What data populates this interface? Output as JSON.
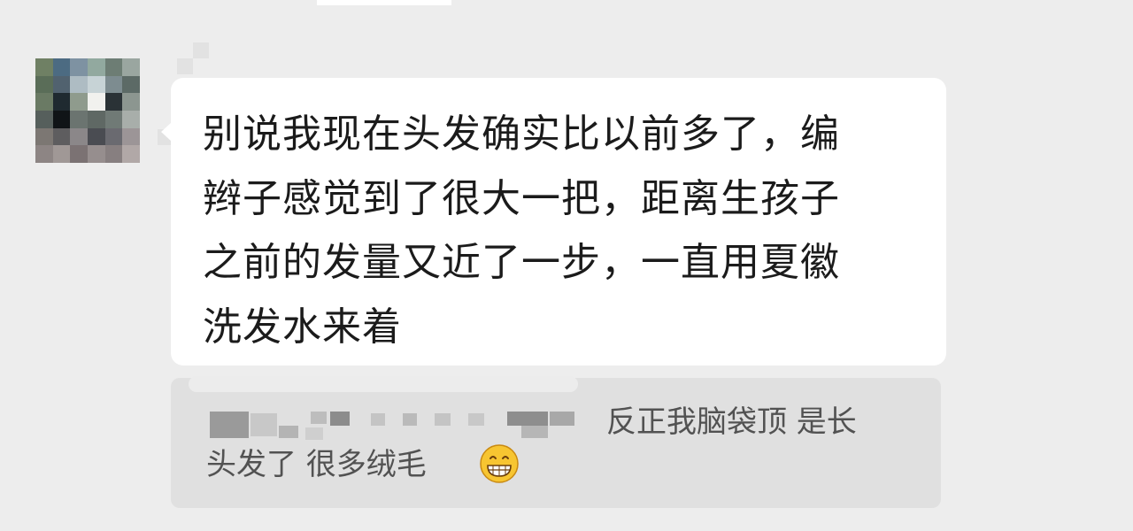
{
  "chat": {
    "message": {
      "lines": [
        "别说我现在头发确实比以前多了，编",
        "辫子感觉到了很大一把，距离生孩子",
        "之前的发量又近了一步，一直用夏徽",
        "洗发水来着"
      ]
    },
    "quote": {
      "line1": "反正我脑袋顶 是长",
      "line2": "头发了  很多绒毛",
      "emoji": "grinning-face-icon"
    }
  },
  "colors": {
    "background": "#ededed",
    "bubble": "#ffffff",
    "quote_bg": "#e0e0e0",
    "message_text": "#1b1b1b",
    "quote_text": "#525252"
  }
}
